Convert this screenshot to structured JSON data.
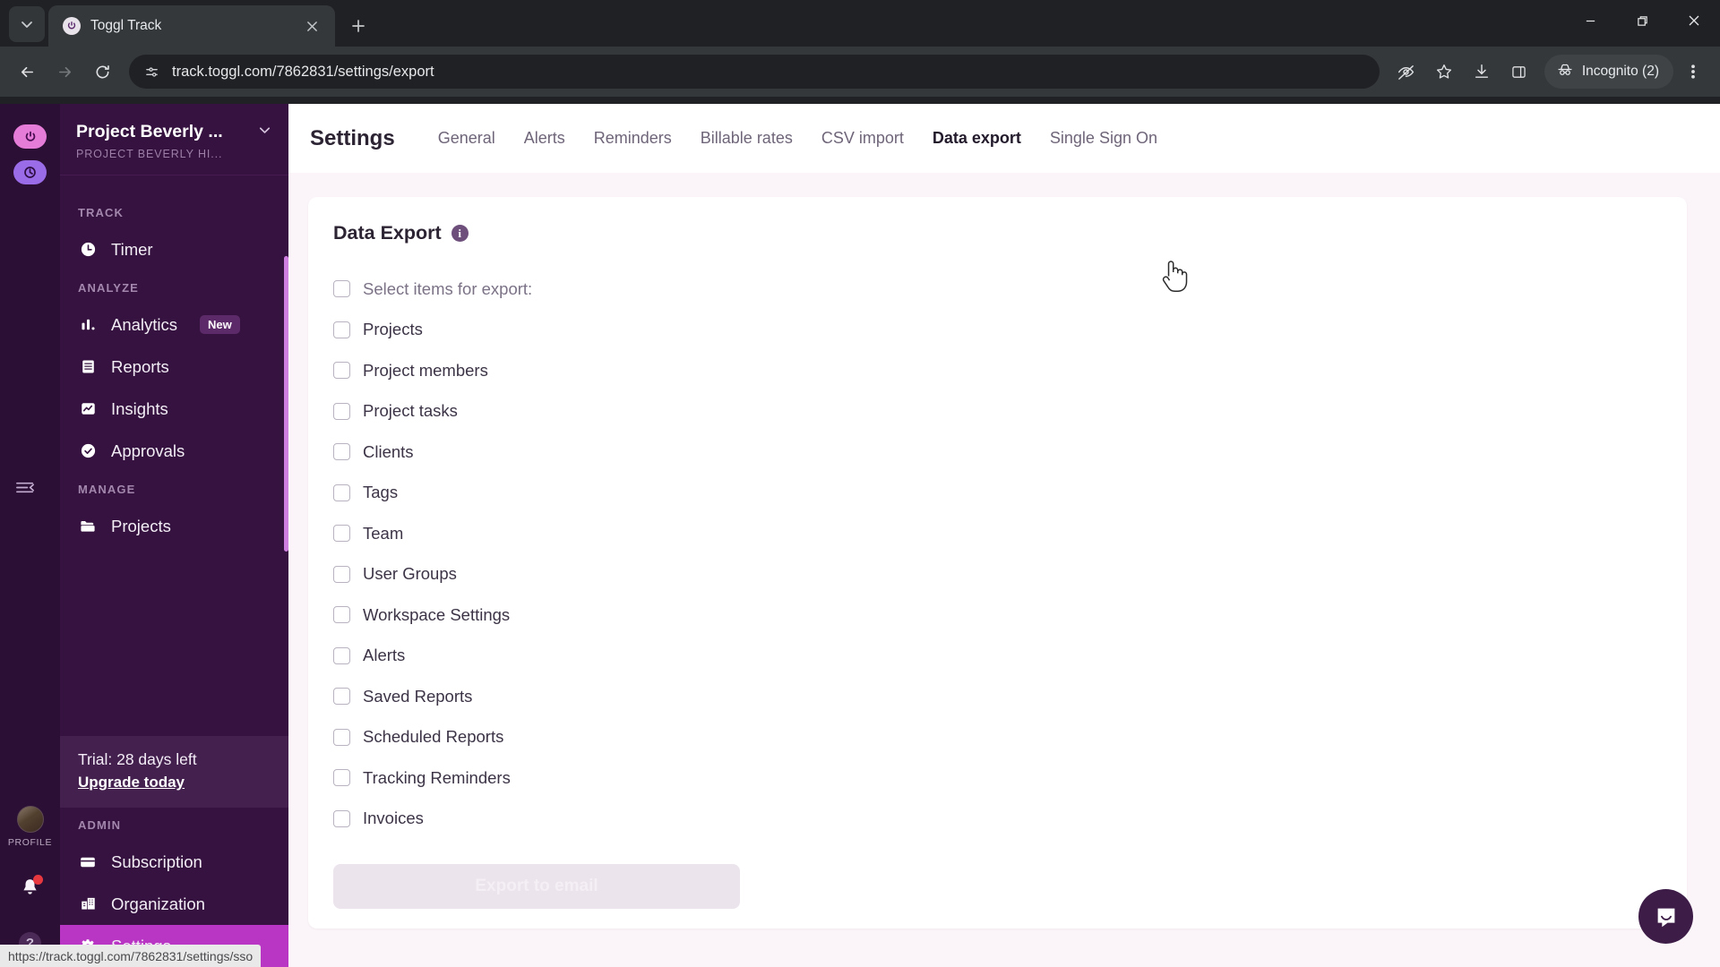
{
  "browser": {
    "tab": {
      "title": "Toggl Track",
      "favicon_icon": "toggl-power-icon"
    },
    "url": "track.toggl.com/7862831/settings/export",
    "profile_label": "Incognito (2)",
    "icons": {
      "tab_search": "tab-search-chevron-icon",
      "new_tab": "new-tab-plus-icon",
      "tab_close": "close-icon",
      "back": "back-arrow-icon",
      "forward": "forward-arrow-icon",
      "reload": "reload-icon",
      "site_info": "site-settings-icon",
      "tracking_protection": "eye-crossed-icon",
      "bookmark": "star-icon",
      "downloads": "download-icon",
      "side_panel": "side-panel-icon",
      "incognito": "incognito-hat-icon",
      "menu": "three-dot-menu-icon",
      "minimize": "minimize-icon",
      "maximize": "maximize-icon",
      "close_window": "window-close-icon"
    }
  },
  "status_bar": {
    "link_url": "https://track.toggl.com/7862831/settings/sso"
  },
  "rail": {
    "logo_top_icon": "toggl-power-logo",
    "logo_bottom_icon": "toggl-track-logo",
    "collapse_icon": "collapse-sidebar-icon",
    "profile_label": "PROFILE",
    "avatar_icon": "user-avatar",
    "notifications_icon": "bell-icon",
    "help_icon": "help-question-icon"
  },
  "sidebar": {
    "workspace_name": "Project Beverly ...",
    "workspace_subtitle": "PROJECT BEVERLY HI...",
    "workspace_chevron_icon": "chevron-down-icon",
    "sections": [
      {
        "label": "TRACK",
        "items": [
          {
            "label": "Timer",
            "icon": "clock-icon",
            "active": false,
            "badge": ""
          }
        ]
      },
      {
        "label": "ANALYZE",
        "items": [
          {
            "label": "Analytics",
            "icon": "bar-chart-icon",
            "active": false,
            "badge": "New"
          },
          {
            "label": "Reports",
            "icon": "report-list-icon",
            "active": false,
            "badge": ""
          },
          {
            "label": "Insights",
            "icon": "insights-chart-icon",
            "active": false,
            "badge": ""
          },
          {
            "label": "Approvals",
            "icon": "check-circle-icon",
            "active": false,
            "badge": ""
          }
        ]
      },
      {
        "label": "MANAGE",
        "items": [
          {
            "label": "Projects",
            "icon": "folder-icon",
            "active": false,
            "badge": ""
          }
        ]
      }
    ],
    "trial": {
      "text": "Trial: 28 days left",
      "link": "Upgrade today"
    },
    "admin": {
      "label": "ADMIN",
      "items": [
        {
          "label": "Subscription",
          "icon": "credit-card-icon",
          "active": false
        },
        {
          "label": "Organization",
          "icon": "building-icon",
          "active": false
        },
        {
          "label": "Settings",
          "icon": "gear-icon",
          "active": true
        }
      ]
    }
  },
  "settings": {
    "title": "Settings",
    "tabs": [
      {
        "label": "General",
        "active": false
      },
      {
        "label": "Alerts",
        "active": false
      },
      {
        "label": "Reminders",
        "active": false
      },
      {
        "label": "Billable rates",
        "active": false
      },
      {
        "label": "CSV import",
        "active": false
      },
      {
        "label": "Data export",
        "active": true
      },
      {
        "label": "Single Sign On",
        "active": false
      }
    ]
  },
  "data_export": {
    "title": "Data Export",
    "info_icon": "info-icon",
    "items": [
      {
        "label": "Select items for export:",
        "checked": false,
        "muted": true
      },
      {
        "label": "Projects",
        "checked": false,
        "muted": false
      },
      {
        "label": "Project members",
        "checked": false,
        "muted": false
      },
      {
        "label": "Project tasks",
        "checked": false,
        "muted": false
      },
      {
        "label": "Clients",
        "checked": false,
        "muted": false
      },
      {
        "label": "Tags",
        "checked": false,
        "muted": false
      },
      {
        "label": "Team",
        "checked": false,
        "muted": false
      },
      {
        "label": "User Groups",
        "checked": false,
        "muted": false
      },
      {
        "label": "Workspace Settings",
        "checked": false,
        "muted": false
      },
      {
        "label": "Alerts",
        "checked": false,
        "muted": false
      },
      {
        "label": "Saved Reports",
        "checked": false,
        "muted": false
      },
      {
        "label": "Scheduled Reports",
        "checked": false,
        "muted": false
      },
      {
        "label": "Tracking Reminders",
        "checked": false,
        "muted": false
      },
      {
        "label": "Invoices",
        "checked": false,
        "muted": false
      }
    ],
    "export_button": {
      "label": "Export to email",
      "disabled": true
    }
  },
  "chat": {
    "icon": "chat-bubble-icon"
  },
  "colors": {
    "sidebar_bg": "#35123f",
    "rail_bg": "#2c0f35",
    "active_nav": "#b936c4",
    "page_bg": "#fbf4f8",
    "card_bg": "#ffffff",
    "accent_pink": "#e57cd8",
    "accent_purple": "#9b6ce8"
  }
}
